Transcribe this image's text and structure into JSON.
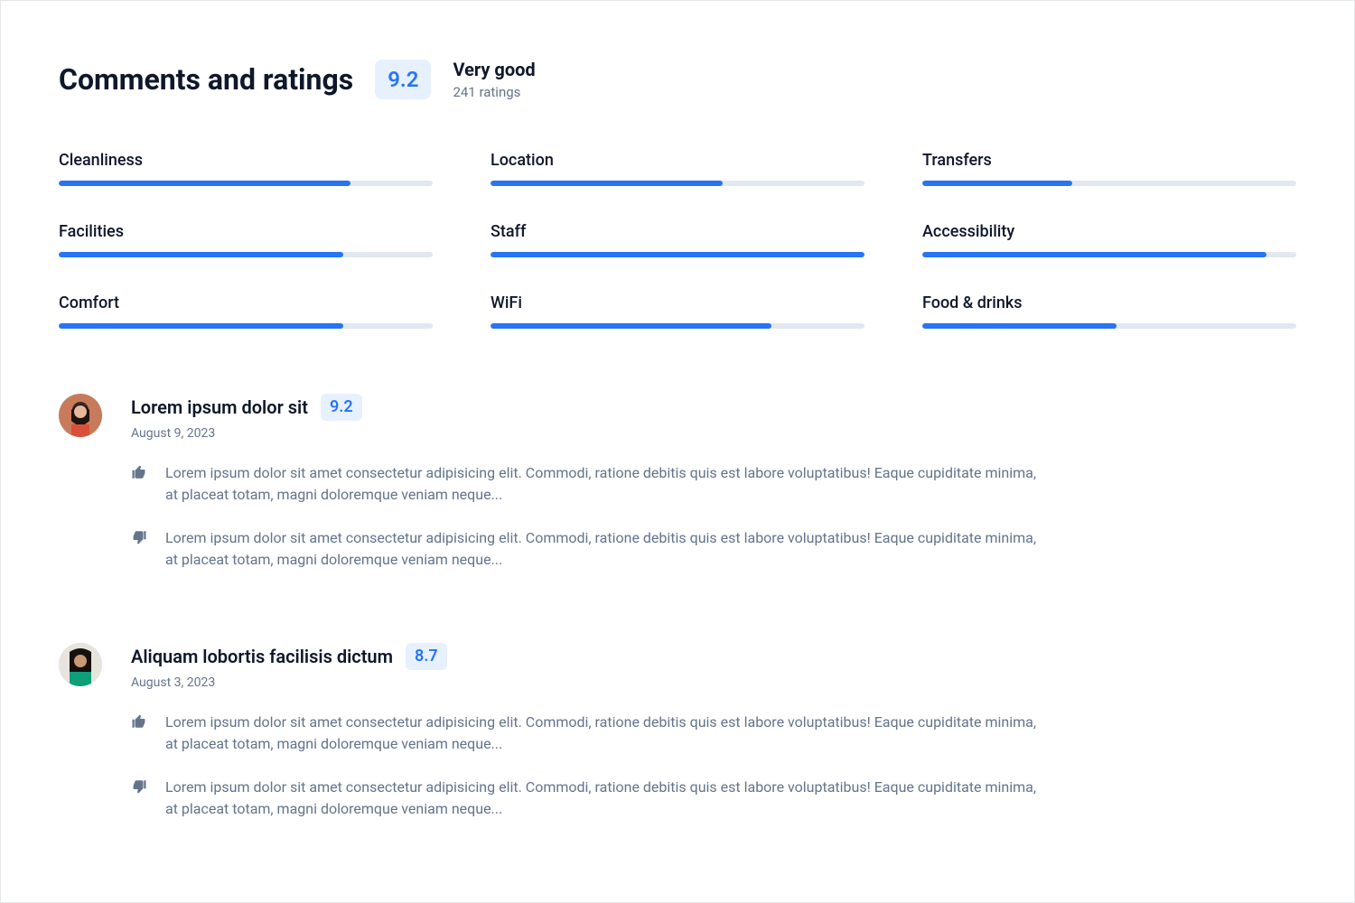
{
  "header": {
    "title": "Comments and ratings",
    "score": "9.2",
    "summary_label": "Very good",
    "ratings_count": "241 ratings"
  },
  "bars": [
    {
      "label": "Cleanliness",
      "pct": 78
    },
    {
      "label": "Location",
      "pct": 62
    },
    {
      "label": "Transfers",
      "pct": 40
    },
    {
      "label": "Facilities",
      "pct": 76
    },
    {
      "label": "Staff",
      "pct": 100
    },
    {
      "label": "Accessibility",
      "pct": 92
    },
    {
      "label": "Comfort",
      "pct": 76
    },
    {
      "label": "WiFi",
      "pct": 75
    },
    {
      "label": "Food & drinks",
      "pct": 52
    }
  ],
  "reviews": [
    {
      "title": "Lorem ipsum dolor sit",
      "score": "9.2",
      "date": "August 9, 2023",
      "positive": "Lorem ipsum dolor sit amet consectetur adipisicing elit. Commodi, ratione debitis quis est labore voluptatibus! Eaque cupiditate minima, at placeat totam, magni doloremque veniam neque...",
      "negative": "Lorem ipsum dolor sit amet consectetur adipisicing elit. Commodi, ratione debitis quis est labore voluptatibus! Eaque cupiditate minima, at placeat totam, magni doloremque veniam neque..."
    },
    {
      "title": "Aliquam lobortis facilisis dictum",
      "score": "8.7",
      "date": "August 3, 2023",
      "positive": "Lorem ipsum dolor sit amet consectetur adipisicing elit. Commodi, ratione debitis quis est labore voluptatibus! Eaque cupiditate minima, at placeat totam, magni doloremque veniam neque...",
      "negative": "Lorem ipsum dolor sit amet consectetur adipisicing elit. Commodi, ratione debitis quis est labore voluptatibus! Eaque cupiditate minima, at placeat totam, magni doloremque veniam neque..."
    }
  ]
}
